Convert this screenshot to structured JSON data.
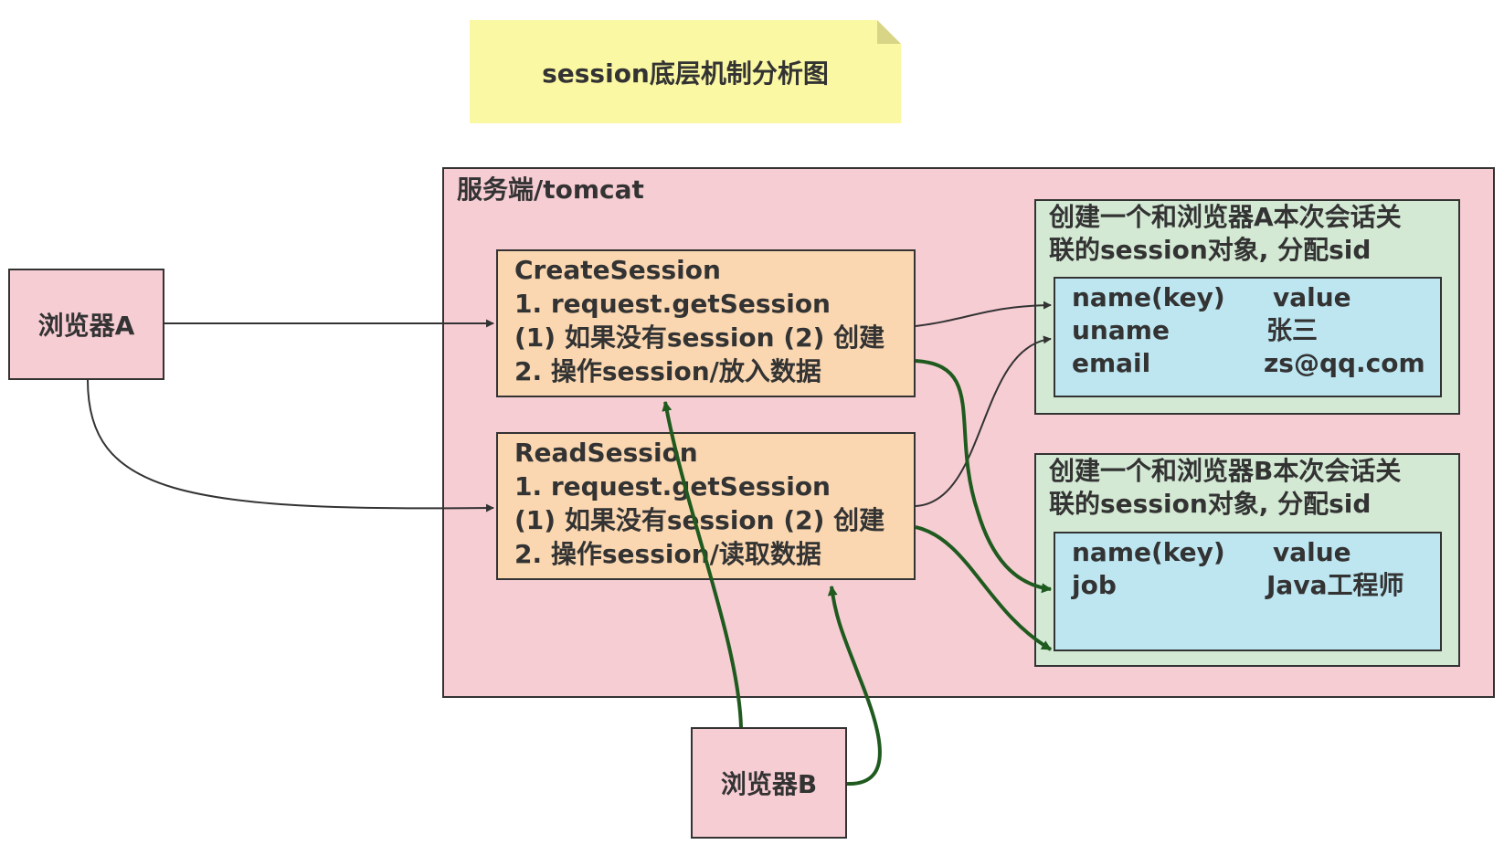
{
  "title": "session底层机制分析图",
  "server": {
    "label": "服务端/tomcat"
  },
  "browsers": {
    "a": "浏览器A",
    "b": "浏览器B"
  },
  "handlers": {
    "create": {
      "name": "CreateSession",
      "line1": "1. request.getSession",
      "line2": "(1) 如果没有session (2) 创建",
      "line3": "2. 操作session/放入数据"
    },
    "read": {
      "name": "ReadSession",
      "line1": "1. request.getSession",
      "line2": "(1) 如果没有session (2) 创建",
      "line3": "2. 操作session/读取数据"
    }
  },
  "sessions": {
    "a": {
      "title_line1": "创建一个和浏览器A本次会话关",
      "title_line2": "联的session对象, 分配sid",
      "header": {
        "key": "name(key)",
        "value": "value"
      },
      "rows": [
        {
          "key": "uname",
          "value": "张三"
        },
        {
          "key": "email",
          "value": "zs@qq.com"
        }
      ]
    },
    "b": {
      "title_line1": "创建一个和浏览器B本次会话关",
      "title_line2": "联的session对象, 分配sid",
      "header": {
        "key": "name(key)",
        "value": "value"
      },
      "rows": [
        {
          "key": "job",
          "value": "Java工程师"
        }
      ]
    }
  },
  "colors": {
    "note": "#fbf8a3",
    "server": "#f7cdd4",
    "handler": "#fad7b1",
    "session": "#d3e9d4",
    "kv": "#bde6f1",
    "arrow_a": "#333333",
    "arrow_b": "#1f5a1f"
  }
}
